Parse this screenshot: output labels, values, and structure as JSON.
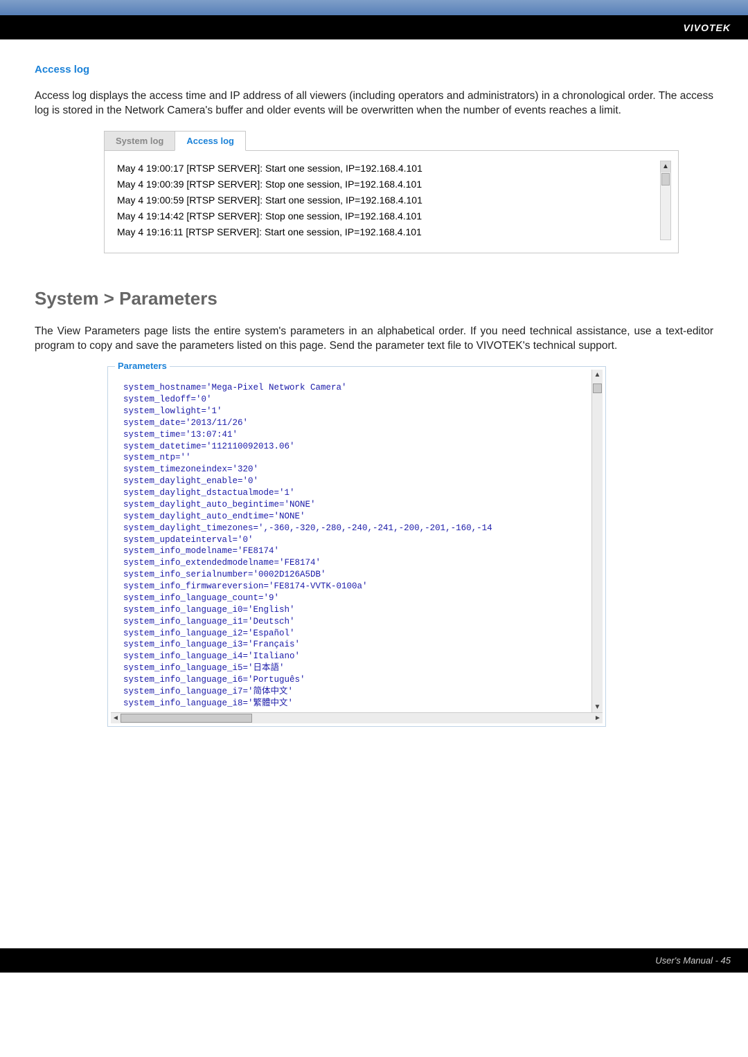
{
  "brand": "VIVOTEK",
  "section": {
    "access_log_heading": "Access log",
    "access_log_intro": "Access log displays the access time and IP address of all viewers (including operators and administrators) in a chronological order. The access log is stored in the Network Camera's buffer and older events will be overwritten when the number of events reaches a limit."
  },
  "tabs": {
    "system_log": "System log",
    "access_log": "Access log"
  },
  "log_lines": [
    "May 4 19:00:17 [RTSP SERVER]: Start one session, IP=192.168.4.101",
    "May 4 19:00:39 [RTSP SERVER]: Stop one session, IP=192.168.4.101",
    "May 4 19:00:59 [RTSP SERVER]: Start one session, IP=192.168.4.101",
    "May 4 19:14:42 [RTSP SERVER]: Stop one session, IP=192.168.4.101",
    "May 4 19:16:11 [RTSP SERVER]: Start one session, IP=192.168.4.101"
  ],
  "params_heading": "System > Parameters",
  "params_intro": "The View Parameters page lists the entire system's parameters in an alphabetical order. If you need technical assistance, use a text-editor program to copy and save the parameters listed on this page. Send the parameter text file to VIVOTEK's technical support.",
  "params_legend": "Parameters",
  "params_text": "system_hostname='Mega-Pixel Network Camera'\nsystem_ledoff='0'\nsystem_lowlight='1'\nsystem_date='2013/11/26'\nsystem_time='13:07:41'\nsystem_datetime='112110092013.06'\nsystem_ntp=''\nsystem_timezoneindex='320'\nsystem_daylight_enable='0'\nsystem_daylight_dstactualmode='1'\nsystem_daylight_auto_begintime='NONE'\nsystem_daylight_auto_endtime='NONE'\nsystem_daylight_timezones=',-360,-320,-280,-240,-241,-200,-201,-160,-14\nsystem_updateinterval='0'\nsystem_info_modelname='FE8174'\nsystem_info_extendedmodelname='FE8174'\nsystem_info_serialnumber='0002D126A5DB'\nsystem_info_firmwareversion='FE8174-VVTK-0100a'\nsystem_info_language_count='9'\nsystem_info_language_i0='English'\nsystem_info_language_i1='Deutsch'\nsystem_info_language_i2='Español'\nsystem_info_language_i3='Français'\nsystem_info_language_i4='Italiano'\nsystem_info_language_i5='日本語'\nsystem_info_language_i6='Português'\nsystem_info_language_i7='简体中文'\nsystem_info_language_i8='繁體中文'",
  "footer": "User's Manual - 45"
}
